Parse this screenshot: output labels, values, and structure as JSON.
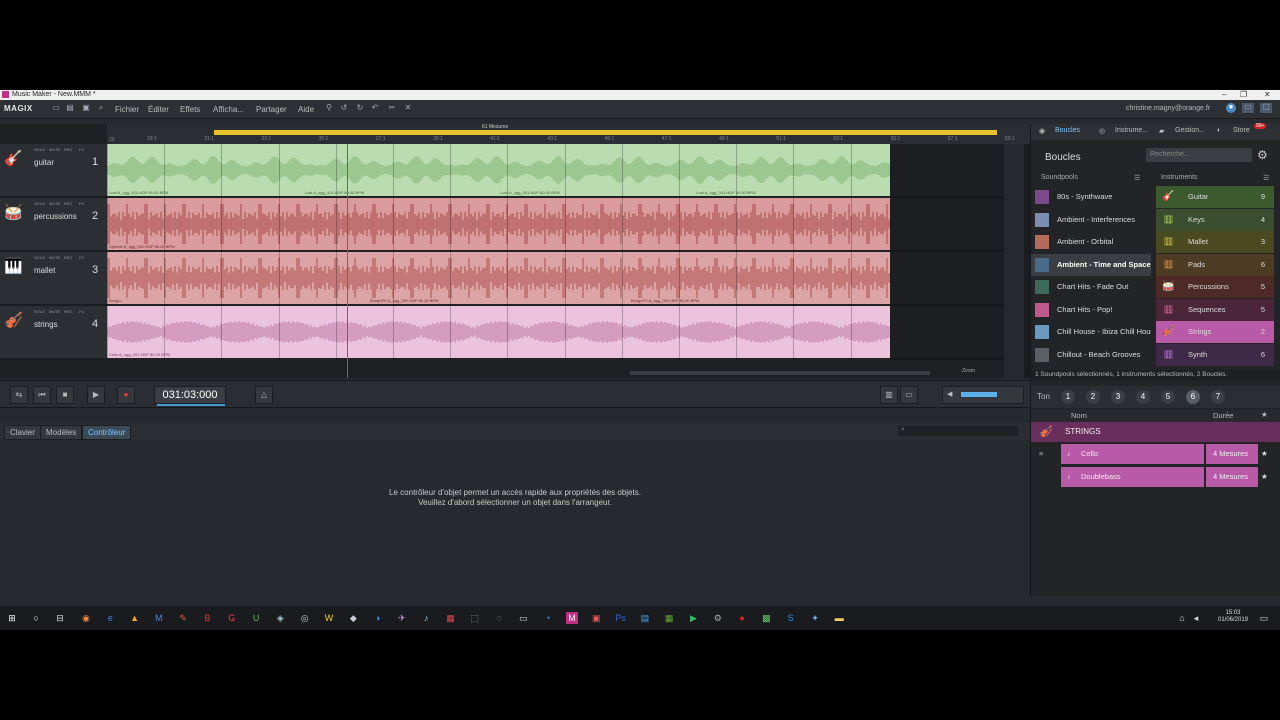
{
  "window": {
    "title": "Music Maker - New.MMM *",
    "controls": [
      "–",
      "❐",
      "✕"
    ]
  },
  "menubar": {
    "logo": "MAGIX",
    "items": [
      "Fichier",
      "Éditer",
      "Effets",
      "Afficha...",
      "Partager",
      "Aide"
    ],
    "account": "christine.magny@orange.fr"
  },
  "ruler": {
    "loop_label": "61 Mesures",
    "markers": [
      "29:1",
      "31:1",
      "33:1",
      "35:1",
      "37:1",
      "39:1",
      "41:1",
      "43:1",
      "45:1",
      "47:1",
      "49:1",
      "51:1",
      "53:1",
      "55:1",
      "57:1",
      "59:1"
    ],
    "start_marker": "29"
  },
  "tracks": [
    {
      "name": "guitar",
      "number": "1",
      "icon": "guitar-icon",
      "glyph": "🎸",
      "color": "#b9dcb0",
      "wave": "#8fbe84",
      "label_color": "#3e6b35",
      "clips": [
        "Lost A_ogg_001.HDP 80.00 BPM",
        "Lost A_ogg_001.HDP 80.00 BPM",
        "Lost A_ogg_001.HDP 80.00 BPM",
        "Lost A_ogg_001.HDP 80.00 BPM"
      ]
    },
    {
      "name": "percussions",
      "number": "2",
      "icon": "drum-icon",
      "glyph": "🥁",
      "color": "#d99b9b",
      "wave": "#b45e5e",
      "label_color": "#6a2b2b",
      "clips": [
        "Djembe A_ogg_001.HDP 80.00 BPM"
      ]
    },
    {
      "name": "mallet",
      "number": "3",
      "icon": "mallet-icon",
      "glyph": "🎹",
      "color": "#dca4a4",
      "wave": "#b96666",
      "label_color": "#6a2b2b",
      "clips": [
        "Bongo...",
        "BongoFX A_ogg_001.HDP 80.00 BPM",
        "BongoFX A_ogg_001.HDP 80.00 BPM"
      ]
    },
    {
      "name": "strings",
      "number": "4",
      "icon": "violin-icon",
      "glyph": "🎻",
      "color": "#ebc3dc",
      "wave": "#c98bb3",
      "label_color": "#7a3566",
      "clips": [
        "Cello A_ogg_001.HDP 80.00 BPM"
      ]
    }
  ],
  "track_header_buttons": [
    "SOLO",
    "MUTE",
    "REC",
    "FX"
  ],
  "transport": {
    "time": "031:03:000",
    "buttons": [
      "⇆",
      "⏮",
      "■",
      "▶",
      "●"
    ],
    "zoom_label": "Zoom"
  },
  "lower_panel": {
    "tabs": [
      "Clavier",
      "Modèles",
      "Contrôleur"
    ],
    "active_tab": "Contrôleur",
    "message_line1": "Le contrôleur d'objet permet un accès rapide aux propriétés des objets.",
    "message_line2": "Veuillez d'abord sélectionner un objet dans l'arrangeur."
  },
  "right_panel": {
    "tabs": [
      "Boucles",
      "Instrume...",
      "Gestion...",
      "Store"
    ],
    "store_badge": "99+",
    "title": "Boucles",
    "search_placeholder": "Recherche...",
    "col_soundpools": "Soundpools",
    "col_instruments": "Instruments",
    "soundpools": [
      {
        "label": "80s - Synthwave",
        "color": "#7a4a8a"
      },
      {
        "label": "Ambient - Interferences",
        "color": "#7a8eb0"
      },
      {
        "label": "Ambient - Orbital",
        "color": "#b56a5a"
      },
      {
        "label": "Ambient - Time and Space",
        "color": "#4a6a8a"
      },
      {
        "label": "Chart Hits - Fade Out",
        "color": "#3e6a5a"
      },
      {
        "label": "Chart Hits - Pop!",
        "color": "#c05a8a"
      },
      {
        "label": "Chill House - Ibiza Chill House",
        "color": "#6a9ac0"
      },
      {
        "label": "Chillout - Beach Grooves",
        "color": "#5a5f66"
      }
    ],
    "instruments": [
      {
        "label": "Guitar",
        "count": "9",
        "bg": "#3b5a2e",
        "icon_color": "#8fd06e",
        "glyph": "🎸"
      },
      {
        "label": "Keys",
        "count": "4",
        "bg": "#3a4d2e",
        "icon_color": "#b6d65a",
        "glyph": "▥"
      },
      {
        "label": "Mallet",
        "count": "3",
        "bg": "#4a4a22",
        "icon_color": "#d6c84a",
        "glyph": "▥"
      },
      {
        "label": "Pads",
        "count": "6",
        "bg": "#4e3b24",
        "icon_color": "#e0a050",
        "glyph": "▥"
      },
      {
        "label": "Percussions",
        "count": "5",
        "bg": "#4e2a26",
        "icon_color": "#e07060",
        "glyph": "🥁"
      },
      {
        "label": "Sequences",
        "count": "5",
        "bg": "#4a2638",
        "icon_color": "#e070a8",
        "glyph": "▥"
      },
      {
        "label": "Strings",
        "count": "2",
        "bg": "#b85aa8",
        "icon_color": "#f0a0e0",
        "glyph": "🎻"
      },
      {
        "label": "Synth",
        "count": "6",
        "bg": "#3e2a48",
        "icon_color": "#c080e0",
        "glyph": "▥"
      }
    ],
    "status": "1 Soundpools sélectionnés, 1 instruments sélectionnés, 2 Boucles.",
    "ton_label": "Ton",
    "ton_numbers": [
      "1",
      "2",
      "3",
      "4",
      "5",
      "6",
      "7"
    ],
    "col_name": "Nom",
    "col_duration": "Durée",
    "category": "STRINGS",
    "loops": [
      {
        "name": "Cello",
        "duration": "4 Mesures"
      },
      {
        "name": "Doublebass",
        "duration": "4 Mesures"
      }
    ]
  },
  "taskbar": {
    "time": "15:03",
    "date": "01/06/2019",
    "apps": [
      "⊞",
      "○",
      "⊟",
      "◉",
      "e",
      "▲",
      "M",
      "✎",
      "B",
      "G",
      "U",
      "◈",
      "◎",
      "W",
      "◆",
      "◑",
      "✈",
      "♪",
      "▦",
      "⬚",
      "◌",
      "▭",
      "◔",
      "M",
      "▣",
      "Ps",
      "▤",
      "▦",
      "▶",
      "⚙",
      "●",
      "▩",
      "S",
      "✦",
      "▬"
    ]
  }
}
